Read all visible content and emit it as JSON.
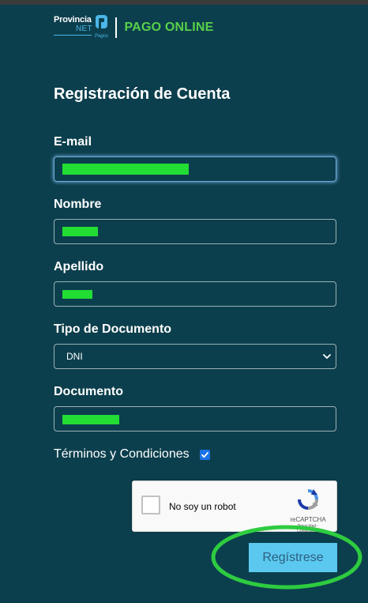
{
  "header": {
    "logo_provincia": "Provincia",
    "logo_net": "NET",
    "logo_pagos": "Pagos",
    "product": "PAGO ONLINE"
  },
  "form": {
    "title": "Registración de Cuenta",
    "email": {
      "label": "E-mail"
    },
    "nombre": {
      "label": "Nombre"
    },
    "apellido": {
      "label": "Apellido"
    },
    "tipo_documento": {
      "label": "Tipo de Documento",
      "selected": "DNI"
    },
    "documento": {
      "label": "Documento"
    },
    "terms": {
      "label": "Términos y Condiciones",
      "checked": true
    },
    "submit_label": "Regístrese"
  },
  "recaptcha": {
    "label": "No soy un robot",
    "brand": "reCAPTCHA",
    "terms": "Privacidad - Condiciones"
  },
  "colors": {
    "background": "#0c3f4d",
    "accent_green": "#58d04a",
    "button": "#5bc8f0",
    "annotation": "#2ecc40"
  },
  "icons": {
    "dropdown": "chevron-down-icon",
    "checkbox": "check-icon",
    "recaptcha": "recaptcha-icon"
  }
}
